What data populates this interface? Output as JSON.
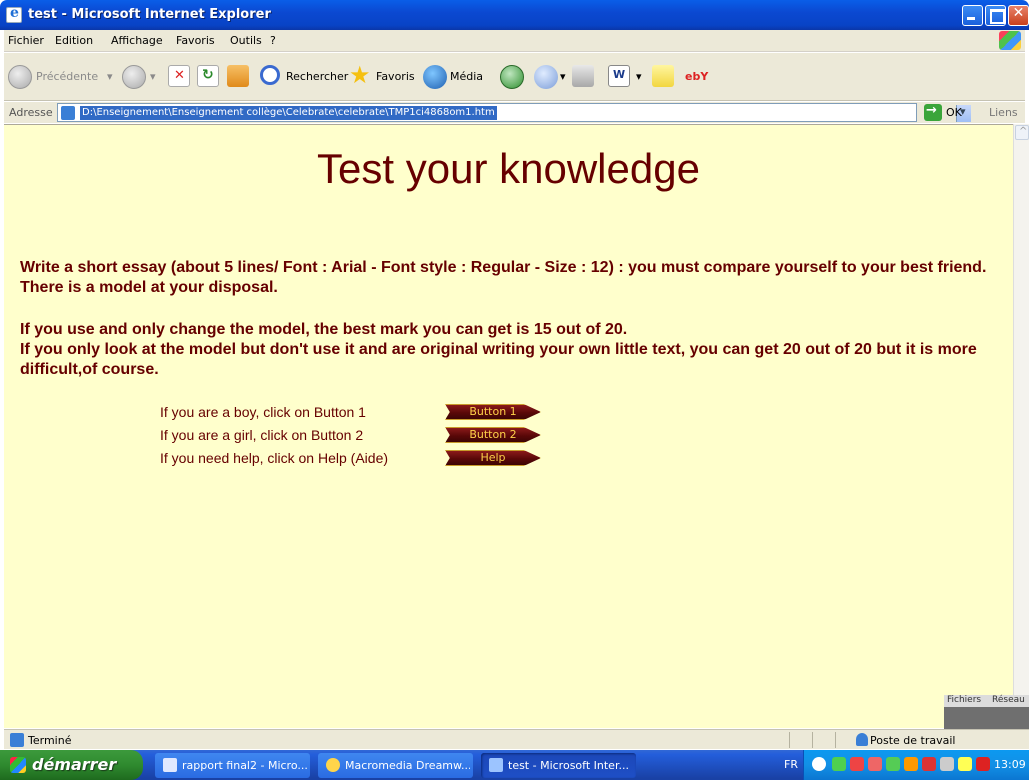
{
  "window": {
    "title": "test - Microsoft Internet Explorer"
  },
  "menu": [
    "Fichier",
    "Edition",
    "Affichage",
    "Favoris",
    "Outils",
    "?"
  ],
  "toolbar": {
    "back": "Précédente",
    "search": "Rechercher",
    "favorites": "Favoris",
    "media": "Média",
    "ebay": "ebY"
  },
  "address": {
    "label": "Adresse",
    "url": "D:\\Enseignement\\Enseignement collège\\Celebrate\\celebrate\\TMP1ci4868om1.htm",
    "go": "OK",
    "links": "Liens"
  },
  "page": {
    "heading": "Test your knowledge",
    "instructions": "Write a short essay (about 5 lines/ Font : Arial - Font style : Regular - Size : 12) : you must compare yourself to your best friend. There is a model at your disposal.",
    "rule1": "If you use and only change the model, the best mark you can get is 15 out of 20.",
    "rule2": "If you only look at the model but don't use it and are original writing your own little text, you can get 20 out of 20 but it is more difficult,of course.",
    "choices": [
      {
        "text": "If you are a boy, click on Button 1",
        "button": "Button 1"
      },
      {
        "text": "If you are a girl, click on Button 2",
        "button": "Button 2"
      },
      {
        "text": "If you need help, click on Help (Aide)",
        "button": "Help"
      }
    ]
  },
  "mini_panel": {
    "tab1": "Fichiers",
    "tab2": "Réseau"
  },
  "status": {
    "text": "Terminé",
    "zone": "Poste de travail"
  },
  "taskbar": {
    "start": "démarrer",
    "tasks": [
      "rapport final2 - Micro...",
      "Macromedia Dreamw...",
      "test - Microsoft Inter..."
    ],
    "lang": "FR",
    "clock": "13:09"
  },
  "colors": {
    "page_bg": "#ffffcc",
    "text": "#660000",
    "button": "#6b0d0d",
    "button_text": "#ffd24a"
  }
}
